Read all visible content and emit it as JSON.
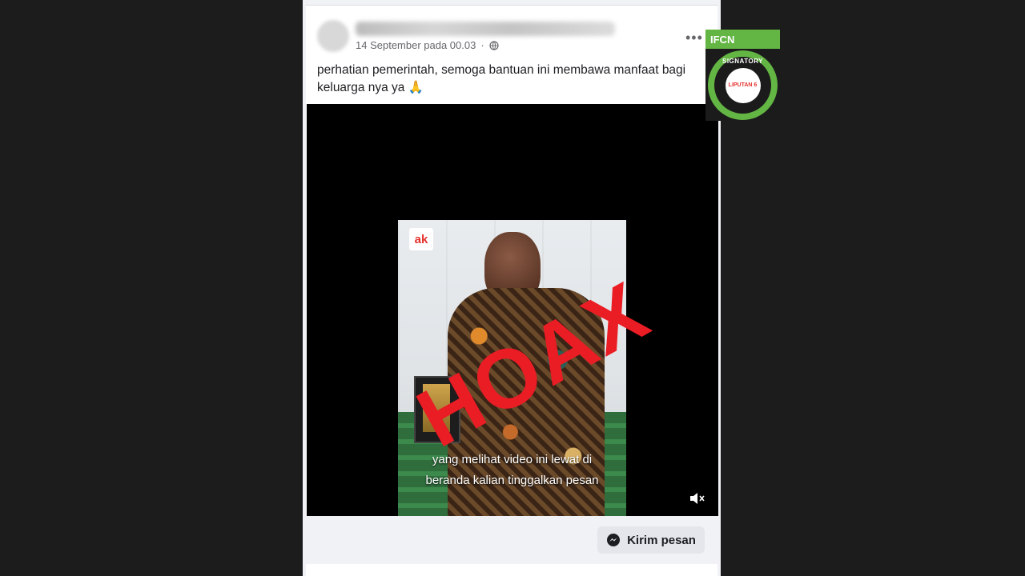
{
  "post": {
    "author_name": "",
    "timestamp": "14 September pada 00.03",
    "caption": "perhatian pemerintah, semoga bantuan ini membawa manfaat bagi keluarga nya ya 🙏",
    "icons": {
      "privacy": "globe-icon",
      "menu": "more-options-icon"
    }
  },
  "video": {
    "logo_text": "ak",
    "subtitle_line1": "yang melihat video ini lewat di",
    "subtitle_line2": "beranda kalian tinggalkan pesan",
    "overlay_text": "HOAX",
    "overlay_color": "#ea1c24",
    "mute_icon": "mute-icon"
  },
  "actions": {
    "send_message_label": "Kirim pesan",
    "send_message_icon": "messenger-icon"
  },
  "badge": {
    "org": "IFCN",
    "signatory": "SIGNATORY",
    "member": "LIPUTAN 6",
    "accent": "#63b544"
  }
}
